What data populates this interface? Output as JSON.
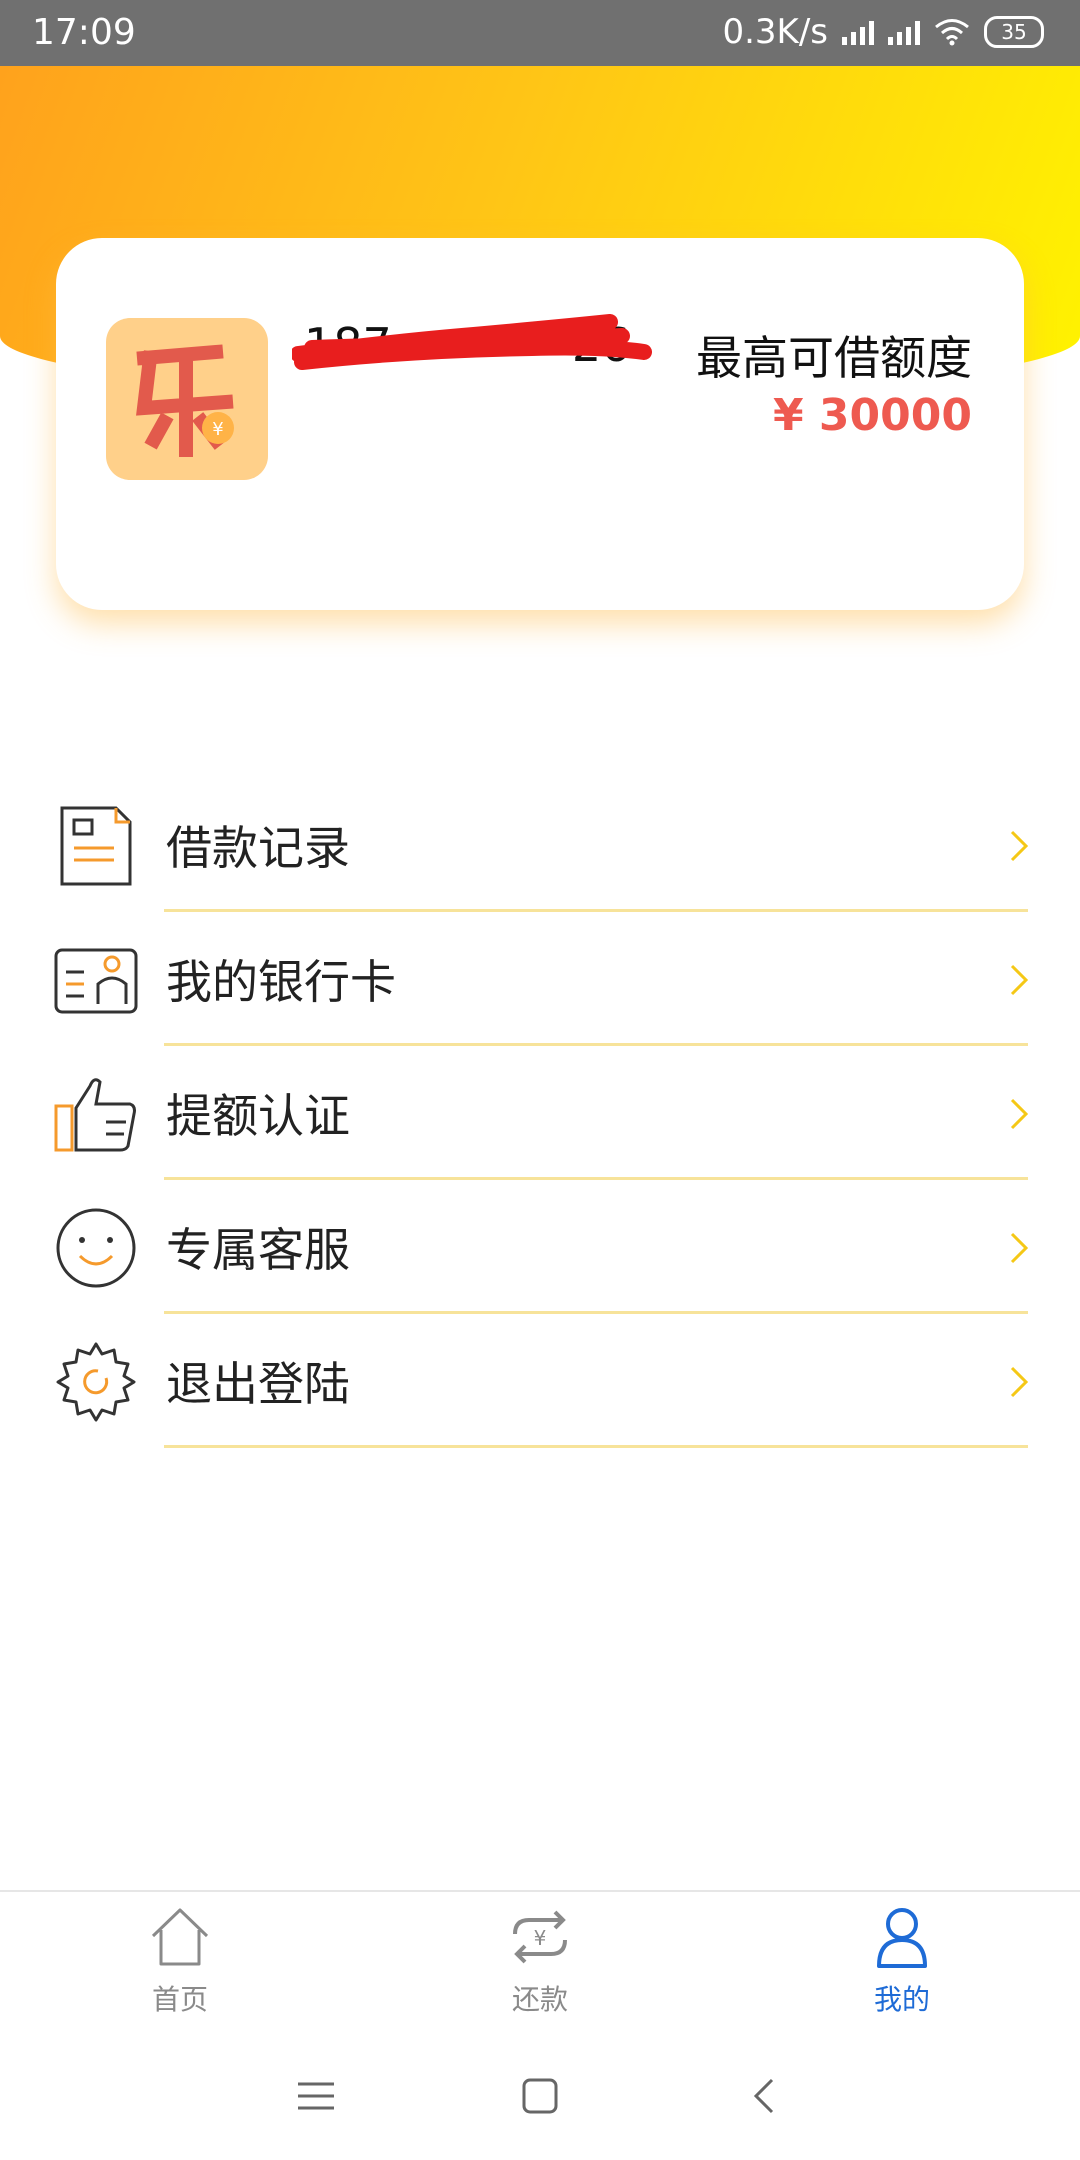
{
  "status_bar": {
    "time": "17:09",
    "network_speed": "0.3K/s",
    "battery": "35"
  },
  "profile": {
    "app_icon": "le-logo-icon",
    "phone_visible_prefix": "187",
    "phone_visible_suffix": "26",
    "limit_label": "最高可借额度",
    "limit_value": "¥ 30000"
  },
  "menu": {
    "items": [
      {
        "label": "借款记录",
        "icon": "document-icon"
      },
      {
        "label": "我的银行卡",
        "icon": "id-card-icon"
      },
      {
        "label": "提额认证",
        "icon": "thumbs-up-icon"
      },
      {
        "label": "专属客服",
        "icon": "smiley-icon"
      },
      {
        "label": "退出登陆",
        "icon": "gear-icon"
      }
    ]
  },
  "tabs": [
    {
      "label": "首页",
      "icon": "home-icon"
    },
    {
      "label": "还款",
      "icon": "repay-icon"
    },
    {
      "label": "我的",
      "icon": "user-icon",
      "active": true
    }
  ],
  "colors": {
    "accent": "#1E6BD6",
    "amount": "#EE5A50",
    "gradient_start": "#FFA21C",
    "gradient_end": "#FFF300"
  }
}
